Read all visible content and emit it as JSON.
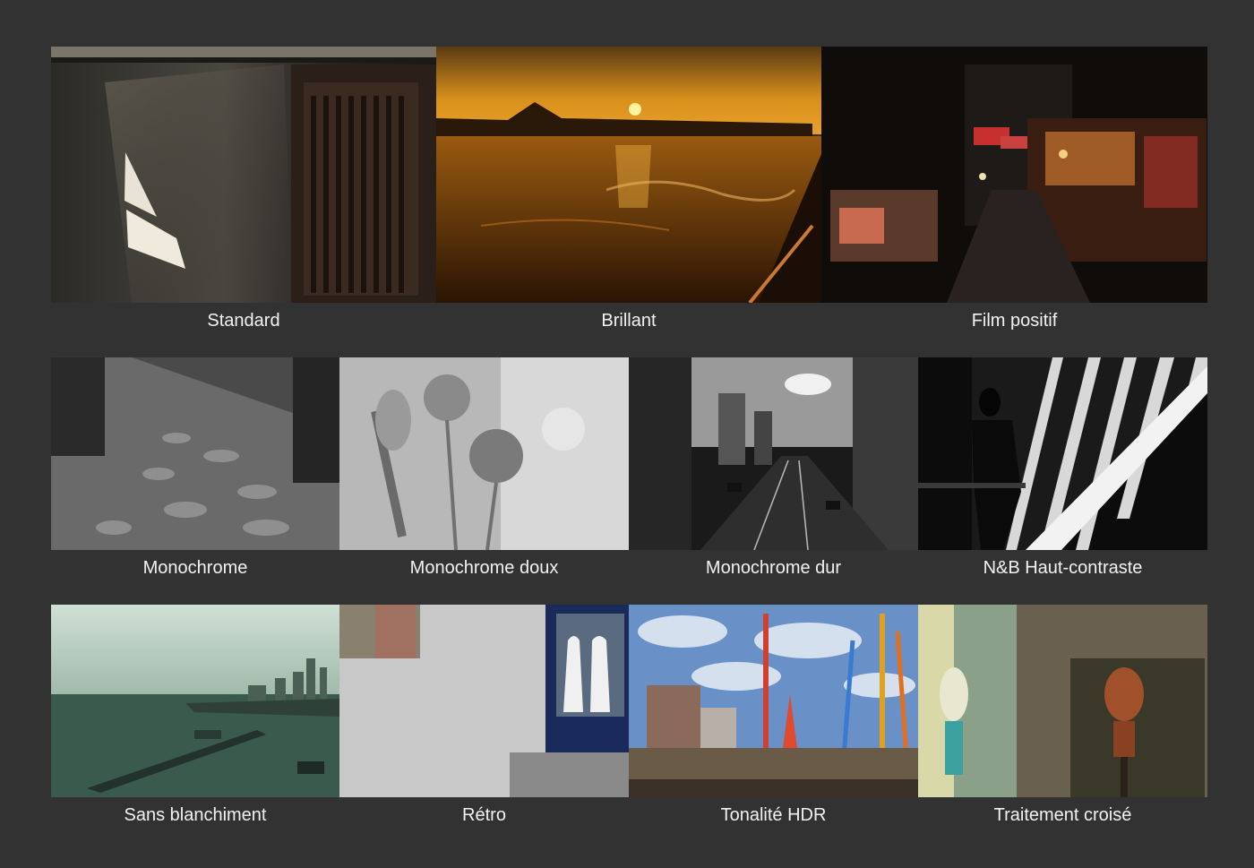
{
  "filters": [
    {
      "id": "standard",
      "label": "Standard"
    },
    {
      "id": "brillant",
      "label": "Brillant"
    },
    {
      "id": "film",
      "label": "Film positif"
    },
    {
      "id": "mono",
      "label": "Monochrome"
    },
    {
      "id": "monodoux",
      "label": "Monochrome doux"
    },
    {
      "id": "monodur",
      "label": "Monochrome dur"
    },
    {
      "id": "nb",
      "label": "N&B Haut-contraste"
    },
    {
      "id": "sans",
      "label": "Sans blanchiment"
    },
    {
      "id": "retro",
      "label": "Rétro"
    },
    {
      "id": "hdr",
      "label": "Tonalité HDR"
    },
    {
      "id": "croise",
      "label": "Traitement croisé"
    }
  ],
  "colors": {
    "background": "#323232",
    "caption_text": "#f2f2f2"
  }
}
